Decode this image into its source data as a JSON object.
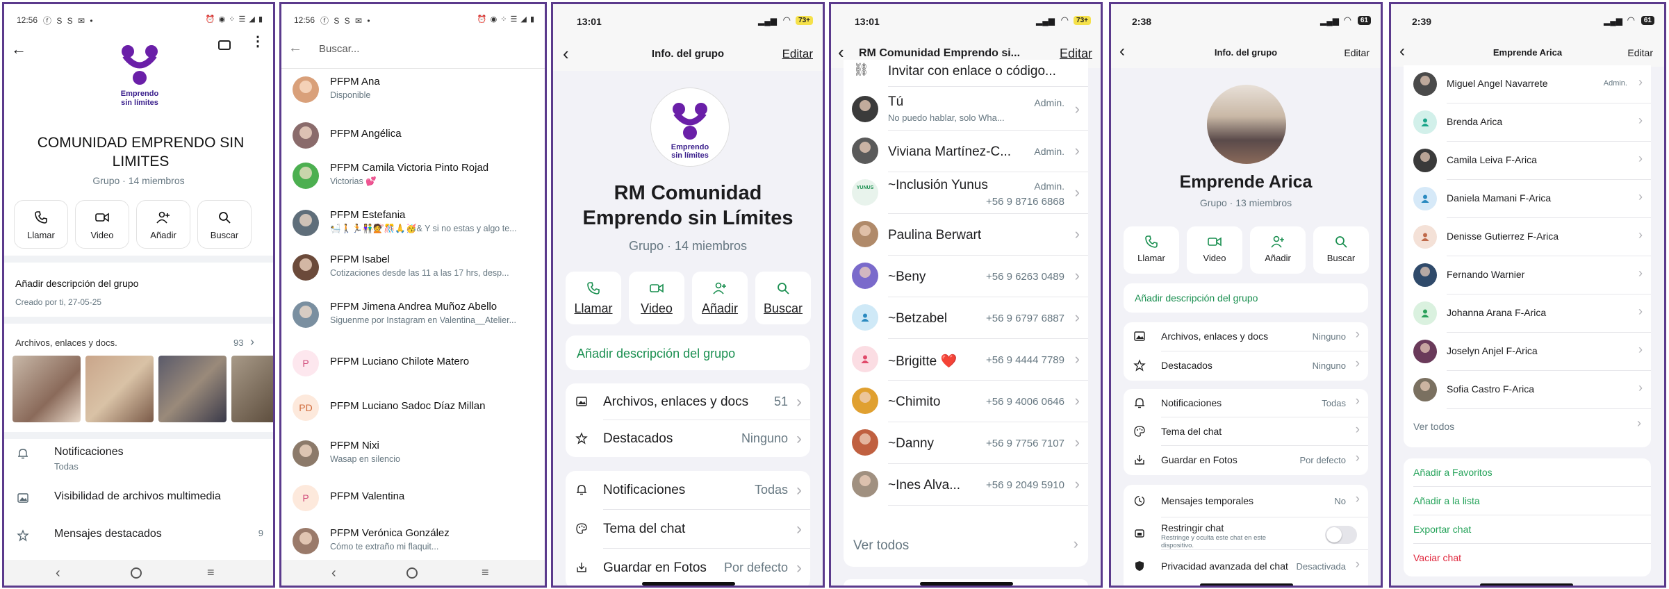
{
  "colors": {
    "frame": "#5b3a8c",
    "brand_purple": "#6a1fa8",
    "wa_green": "#1a8f50",
    "ios_green": "#25a35a",
    "danger": "#e0263c",
    "ios_bg": "#f2f2f7"
  },
  "p1": {
    "time": "12:56",
    "notif_icons": "ⓕ S S ✉ •",
    "right_icons": "⏰ ◉ ⁘ ☰ ◢ ▮",
    "logo_line1": "Emprendo",
    "logo_line2": "sin límites",
    "group_name": "COMUNIDAD EMPRENDO SIN LIMITES",
    "subtitle": "Grupo · 14 miembros",
    "actions": [
      {
        "icon": "phone-icon",
        "label": "Llamar"
      },
      {
        "icon": "video-icon",
        "label": "Video"
      },
      {
        "icon": "add-person-icon",
        "label": "Añadir"
      },
      {
        "icon": "search-icon",
        "label": "Buscar"
      }
    ],
    "desc_title": "Añadir descripción del grupo",
    "created": "Creado por ti, 27-05-25",
    "media_title": "Archivos, enlaces y docs.",
    "media_count": "93",
    "menu": [
      {
        "icon": "bell-icon",
        "label": "Notificaciones",
        "sub": "Todas"
      },
      {
        "icon": "image-icon",
        "label": "Visibilidad de archivos multimedia",
        "sub": ""
      },
      {
        "icon": "star-icon",
        "label": "Mensajes destacados",
        "count": "9"
      }
    ]
  },
  "p2": {
    "time": "12:56",
    "notif_icons": "ⓕ S S ✉ •",
    "right_icons": "⏰ ◉ ⁘ ☰ ◢ ▮",
    "search_placeholder": "Buscar...",
    "contacts": [
      {
        "name": "PFPM Ana",
        "status": "Disponible",
        "avatar": "photo",
        "color": "#d9a07a"
      },
      {
        "name": "PFPM Angélica",
        "status": "",
        "avatar": "photo",
        "color": "#8a6b6b"
      },
      {
        "name": "PFPM Camila Victoria Pinto Rojad",
        "status": "Victorias 💕",
        "avatar": "photo",
        "color": "#4caf50"
      },
      {
        "name": "PFPM Estefania",
        "status": "🛀🚶🏃👫💇🎊🙏🥳& Y si no estas y algo te...",
        "avatar": "photo",
        "color": "#5f6e7a"
      },
      {
        "name": "PFPM Isabel",
        "status": "Cotizaciones desde las 11 a las 17 hrs, desp...",
        "avatar": "photo",
        "color": "#6b4a3a"
      },
      {
        "name": "PFPM Jimena Andrea Muñoz Abello",
        "status": "Siguenme por Instagram en Valentina__Atelier...",
        "avatar": "photo",
        "color": "#7a8fa0"
      },
      {
        "name": "PFPM Luciano Chilote Matero",
        "status": "",
        "avatar": "P",
        "color": "#fde7ee"
      },
      {
        "name": "PFPM Luciano Sadoc Díaz Millan",
        "status": "",
        "avatar": "PD",
        "color": "#fde9dc"
      },
      {
        "name": "PFPM Nixi",
        "status": "Wasap en silencio",
        "avatar": "photo",
        "color": "#8c7a6a"
      },
      {
        "name": "PFPM Valentina",
        "status": "",
        "avatar": "P",
        "color": "#fde9dc"
      },
      {
        "name": "PFPM Verónica González",
        "status": "Cómo te extraño mi flaquit...",
        "avatar": "photo",
        "color": "#9a7a6a"
      }
    ]
  },
  "p3": {
    "time": "13:01",
    "battery": "73+",
    "title": "Info. del grupo",
    "edit": "Editar",
    "logo_line1": "Emprendo",
    "logo_line2": "sin límites",
    "group_name_1": "RM Comunidad",
    "group_name_2": "Emprendo sin Límites",
    "subtitle": "Grupo · 14 miembros",
    "actions": [
      {
        "icon": "phone-icon",
        "label": "Llamar"
      },
      {
        "icon": "video-icon",
        "label": "Video"
      },
      {
        "icon": "add-person-icon",
        "label": "Añadir"
      },
      {
        "icon": "search-icon",
        "label": "Buscar"
      }
    ],
    "add_desc": "Añadir descripción del grupo",
    "rows1": [
      {
        "icon": "image-icon",
        "label": "Archivos, enlaces y docs",
        "value": "51"
      },
      {
        "icon": "star-icon",
        "label": "Destacados",
        "value": "Ninguno"
      }
    ],
    "rows2": [
      {
        "icon": "bell-icon",
        "label": "Notificaciones",
        "value": "Todas"
      },
      {
        "icon": "palette-icon",
        "label": "Tema del chat",
        "value": ""
      },
      {
        "icon": "download-icon",
        "label": "Guardar en Fotos",
        "value": "Por defecto"
      }
    ]
  },
  "p4": {
    "time": "13:01",
    "battery": "73+",
    "title": "RM Comunidad Emprendo si...",
    "edit": "Editar",
    "invite": "Invitar con enlace o código...",
    "members": [
      {
        "name": "Tú",
        "sub": "No puedo hablar, solo Wha...",
        "right": "Admin.",
        "avatar": "photo",
        "color": "#3b3b3b"
      },
      {
        "name": "Viviana Martínez-C...",
        "sub": "",
        "right": "Admin.",
        "avatar": "photo",
        "color": "#5a5a5a"
      },
      {
        "name": "~Inclusión Yunus",
        "sub": "",
        "right": "Admin.",
        "right2": "+56 9 8716 6868",
        "avatar": "logo",
        "color": "#e8f3ec"
      },
      {
        "name": "Paulina Berwart",
        "sub": "",
        "right": "",
        "avatar": "photo",
        "color": "#b08a6a"
      },
      {
        "name": "~Beny",
        "sub": "",
        "right": "+56 9 6263 0489",
        "avatar": "photo",
        "color": "#7a6acb"
      },
      {
        "name": "~Betzabel",
        "sub": "",
        "right": "+56 9 6797 6887",
        "avatar": "default",
        "color": "#cfe9f7"
      },
      {
        "name": "~Brigitte ❤️",
        "sub": "",
        "right": "+56 9 4444 7789",
        "avatar": "default",
        "color": "#fbdde3"
      },
      {
        "name": "~Chimito",
        "sub": "",
        "right": "+56 9 4006 0646",
        "avatar": "photo",
        "color": "#e0a030"
      },
      {
        "name": "~Danny",
        "sub": "",
        "right": "+56 9 7756 7107",
        "avatar": "photo",
        "color": "#c06040"
      },
      {
        "name": "~Ines Alva...",
        "sub": "",
        "right": "+56 9 2049 5910",
        "avatar": "photo",
        "color": "#a09080"
      }
    ],
    "see_all": "Ver todos"
  },
  "p5": {
    "time": "2:38",
    "battery": "61",
    "title": "Info. del grupo",
    "edit": "Editar",
    "group_name": "Emprende Arica",
    "subtitle": "Grupo · 13 miembros",
    "actions": [
      {
        "icon": "phone-icon",
        "label": "Llamar"
      },
      {
        "icon": "video-icon",
        "label": "Video"
      },
      {
        "icon": "add-person-icon",
        "label": "Añadir"
      },
      {
        "icon": "search-icon",
        "label": "Buscar"
      }
    ],
    "add_desc": "Añadir descripción del grupo",
    "rows1": [
      {
        "icon": "image-icon",
        "label": "Archivos, enlaces y docs",
        "value": "Ninguno"
      },
      {
        "icon": "star-icon",
        "label": "Destacados",
        "value": "Ninguno"
      }
    ],
    "rows2": [
      {
        "icon": "bell-icon",
        "label": "Notificaciones",
        "value": "Todas"
      },
      {
        "icon": "palette-icon",
        "label": "Tema del chat",
        "value": ""
      },
      {
        "icon": "download-icon",
        "label": "Guardar en Fotos",
        "value": "Por defecto"
      }
    ],
    "rows3": [
      {
        "icon": "timer-icon",
        "label": "Mensajes temporales",
        "value": "No"
      },
      {
        "icon": "lock-chat-icon",
        "label": "Restringir chat",
        "sub": "Restringe y oculta este chat en este dispositivo.",
        "value": ""
      },
      {
        "icon": "shield-icon",
        "label": "Privacidad avanzada del chat",
        "value": "Desactivada"
      }
    ]
  },
  "p6": {
    "time": "2:39",
    "battery": "61",
    "title": "Emprende Arica",
    "edit": "Editar",
    "members": [
      {
        "name": "Miguel Angel Navarrete",
        "right": "Admin.",
        "avatar": "photo",
        "color": "#4a4a4a"
      },
      {
        "name": "Brenda Arica",
        "right": "",
        "avatar": "default",
        "color": "#d2f0ea"
      },
      {
        "name": "Camila Leiva F-Arica",
        "right": "",
        "avatar": "photo",
        "color": "#3a3a3a"
      },
      {
        "name": "Daniela Mamani F-Arica",
        "right": "",
        "avatar": "default",
        "color": "#d6e9f8"
      },
      {
        "name": "Denisse Gutierrez F-Arica",
        "right": "",
        "avatar": "default",
        "color": "#f4e1d7"
      },
      {
        "name": "Fernando Warnier",
        "right": "",
        "avatar": "photo",
        "color": "#2f4a6a"
      },
      {
        "name": "Johanna Arana F-Arica",
        "right": "",
        "avatar": "default",
        "color": "#daf1df"
      },
      {
        "name": "Joselyn Anjel F-Arica",
        "right": "",
        "avatar": "photo",
        "color": "#6a3a5a"
      },
      {
        "name": "Sofia Castro F-Arica",
        "right": "",
        "avatar": "photo",
        "color": "#7a7060"
      }
    ],
    "see_all": "Ver todos",
    "actions": [
      {
        "label": "Añadir a Favoritos",
        "danger": false
      },
      {
        "label": "Añadir a la lista",
        "danger": false
      },
      {
        "label": "Exportar chat",
        "danger": false
      },
      {
        "label": "Vaciar chat",
        "danger": true
      }
    ]
  }
}
